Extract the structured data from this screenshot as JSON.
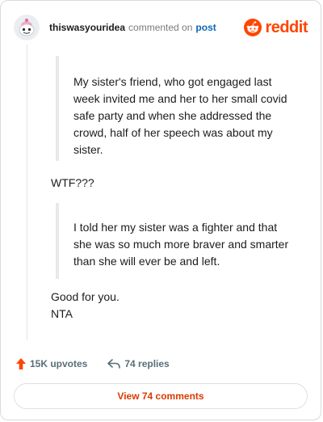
{
  "header": {
    "username": "thiswasyouridea",
    "commented_on": "commented on",
    "post_link": "post",
    "logo_text": "reddit"
  },
  "comment": {
    "quote1": "My sister's friend, who got engaged last week invited me and her to her small covid safe party and when she addressed the crowd, half of her speech was about my sister.",
    "line1": "WTF???",
    "quote2": "I told her my sister was a fighter and that she was so much more braver and smarter than she will ever be and left.",
    "line2": "Good for you.",
    "line3": "NTA"
  },
  "actions": {
    "upvotes": "15K upvotes",
    "replies": "74 replies",
    "view_comments": "View 74 comments"
  },
  "colors": {
    "brand": "#ff4500",
    "link": "#0b67b6",
    "view_comments": "#d93a00"
  }
}
